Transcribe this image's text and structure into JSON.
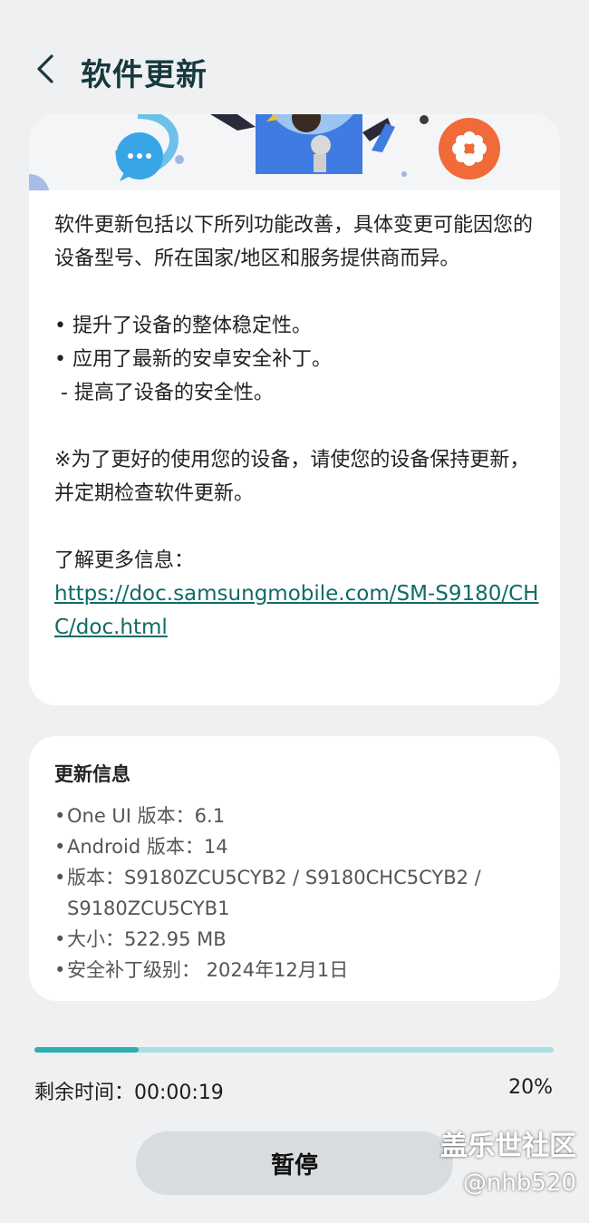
{
  "header": {
    "title": "软件更新"
  },
  "description": {
    "intro": "软件更新包括以下所列功能改善，具体变更可能因您的设备型号、所在国家/地区和服务提供商而异。",
    "items": [
      "• 提升了设备的整体稳定性。",
      "• 应用了最新的安卓安全补丁。",
      " - 提高了设备的安全性。"
    ],
    "note": "※为了更好的使用您的设备，请使您的设备保持更新，并定期检查软件更新。",
    "more_label": "了解更多信息：",
    "more_link": "https://doc.samsungmobile.com/SM-S9180/CHC/doc.html"
  },
  "update_info": {
    "title": "更新信息",
    "rows": [
      "One UI 版本：6.1",
      "Android 版本：14",
      "版本：S9180ZCU5CYB2 / S9180CHC5CYB2 / S9180ZCU5CYB1",
      "大小：522.95 MB",
      "安全补丁级别： 2024年12月1日"
    ]
  },
  "progress": {
    "fraction": 0.2,
    "remaining": "剩余时间：00:00:19",
    "percent": "20%"
  },
  "actions": {
    "pause_label": "暂停"
  },
  "watermark": {
    "line1": "盖乐世社区",
    "line2": "@nhb520"
  },
  "colors": {
    "accent": "#2ab0b1",
    "track": "#a9dfe0",
    "link": "#0f6b66",
    "title": "#15393f"
  }
}
